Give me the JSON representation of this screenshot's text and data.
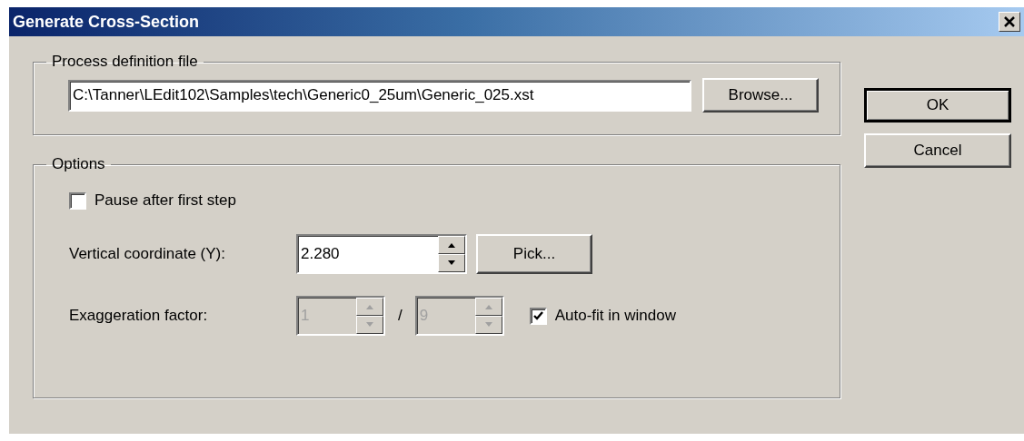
{
  "window": {
    "title": "Generate Cross-Section"
  },
  "process_definition_file": {
    "legend": "Process definition file",
    "path": "C:\\Tanner\\LEdit102\\Samples\\tech\\Generic0_25um\\Generic_025.xst",
    "browse_button": "Browse..."
  },
  "options": {
    "legend": "Options",
    "pause_after_first_step": {
      "label": "Pause after first step",
      "checked": false
    },
    "vertical_coordinate": {
      "label": "Vertical coordinate (Y):",
      "value": "2.280",
      "pick_button": "Pick..."
    },
    "exaggeration": {
      "label": "Exaggeration factor:",
      "numerator": "1",
      "separator": "/",
      "denominator": "9",
      "disabled": true
    },
    "auto_fit": {
      "label": "Auto-fit in window",
      "checked": true
    }
  },
  "buttons": [
    {
      "label": "OK",
      "default": true
    },
    {
      "label": "Cancel",
      "default": false
    }
  ]
}
